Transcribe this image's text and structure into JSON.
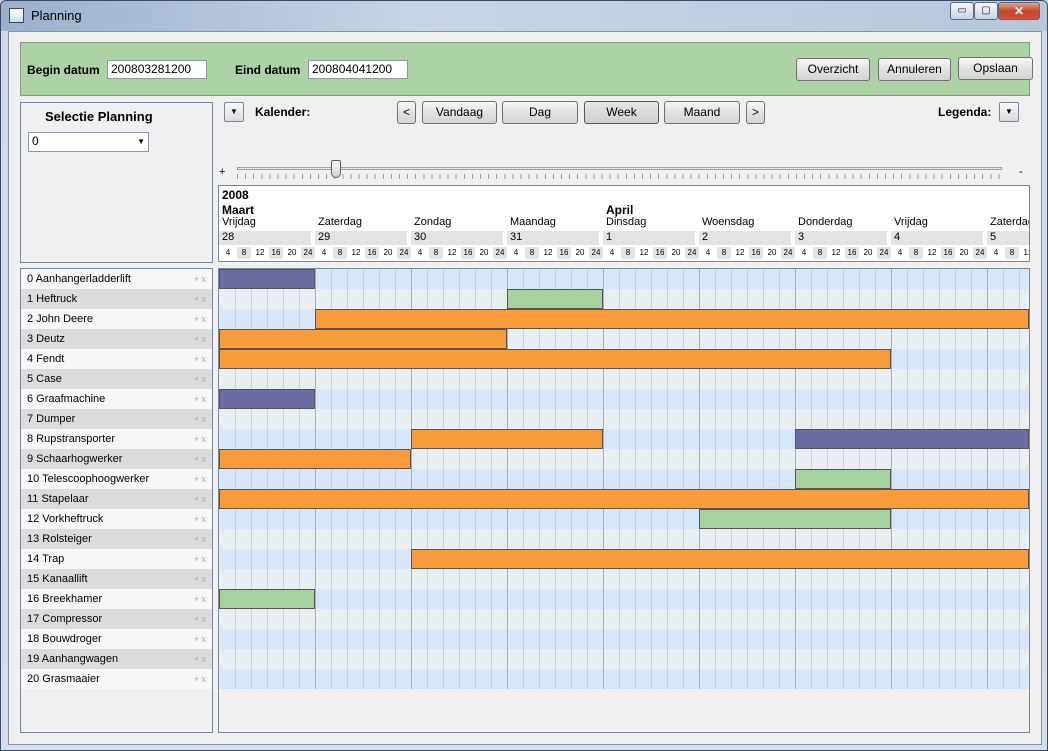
{
  "window": {
    "title": "Planning",
    "minimize": "▭",
    "maximize": "▢",
    "close": "✕"
  },
  "header": {
    "begin_label": "Begin datum",
    "begin_value": "200803281200",
    "end_label": "Eind datum",
    "end_value": "200804041200",
    "buttons": [
      "Overzicht",
      "Annuleren",
      "Opslaan"
    ]
  },
  "selection": {
    "title": "Selectie Planning",
    "value": "0"
  },
  "toolbar": {
    "calendar_label": "Kalender:",
    "prev": "<",
    "next": ">",
    "views": [
      "Vandaag",
      "Dag",
      "Week",
      "Maand"
    ],
    "active_view": "Week",
    "legend_label": "Legenda:",
    "zoom_in": "+",
    "zoom_out": "-",
    "zoom_level": 0.13
  },
  "timeline": {
    "year": "2008",
    "month_markers": [
      {
        "label": "Maart",
        "day_index": 0
      },
      {
        "label": "April",
        "day_index": 4
      }
    ],
    "days": [
      {
        "name": "Vrijdag",
        "num": "28"
      },
      {
        "name": "Zaterdag",
        "num": "29"
      },
      {
        "name": "Zondag",
        "num": "30"
      },
      {
        "name": "Maandag",
        "num": "31"
      },
      {
        "name": "Dinsdag",
        "num": "1"
      },
      {
        "name": "Woensdag",
        "num": "2"
      },
      {
        "name": "Donderdag",
        "num": "3"
      },
      {
        "name": "Vrijdag",
        "num": "4"
      },
      {
        "name": "Zaterdag",
        "num": "5"
      }
    ],
    "hours": [
      "4",
      "8",
      "12",
      "16",
      "20",
      "24"
    ]
  },
  "resources": [
    "0 Aanhangerladderlift",
    "1 Heftruck",
    "2 John Deere",
    "3 Deutz",
    "4 Fendt",
    "5 Case",
    "6 Graafmachine",
    "7 Dumper",
    "8 Rupstransporter",
    "9 Schaarhogwerker",
    "10 Telescoophoogwerker",
    "11 Stapelaar",
    "12 Vorkheftruck",
    "13 Rolsteiger",
    "14 Trap",
    "15 Kanaallift",
    "16 Breekhamer",
    "17 Compressor",
    "18 Bouwdroger",
    "19 Aanhangwagen",
    "20 Grasmaaier"
  ],
  "row_actions": "+ x",
  "colors": {
    "orange": "#f89b3a",
    "purple": "#6b6aa3",
    "green": "#a8d1a0",
    "rowBlue": "#d7e6f8",
    "rowGray": "#e9eef2"
  },
  "bookings": [
    {
      "row": 0,
      "start": 0,
      "end": 1,
      "color": "purple"
    },
    {
      "row": 1,
      "start": 3,
      "end": 4,
      "color": "green"
    },
    {
      "row": 2,
      "start": 1,
      "end": 9,
      "color": "orange"
    },
    {
      "row": 3,
      "start": 0,
      "end": 3,
      "color": "orange"
    },
    {
      "row": 4,
      "start": 0,
      "end": 7,
      "color": "orange"
    },
    {
      "row": 6,
      "start": 0,
      "end": 1,
      "color": "purple"
    },
    {
      "row": 8,
      "start": 2,
      "end": 4,
      "color": "orange"
    },
    {
      "row": 8,
      "start": 6,
      "end": 9,
      "color": "purple"
    },
    {
      "row": 9,
      "start": 0,
      "end": 2,
      "color": "orange"
    },
    {
      "row": 10,
      "start": 6,
      "end": 7,
      "color": "green"
    },
    {
      "row": 11,
      "start": 0,
      "end": 9,
      "color": "orange"
    },
    {
      "row": 12,
      "start": 5,
      "end": 7,
      "color": "green"
    },
    {
      "row": 14,
      "start": 2,
      "end": 9,
      "color": "orange"
    },
    {
      "row": 16,
      "start": 0,
      "end": 1,
      "color": "green"
    }
  ]
}
